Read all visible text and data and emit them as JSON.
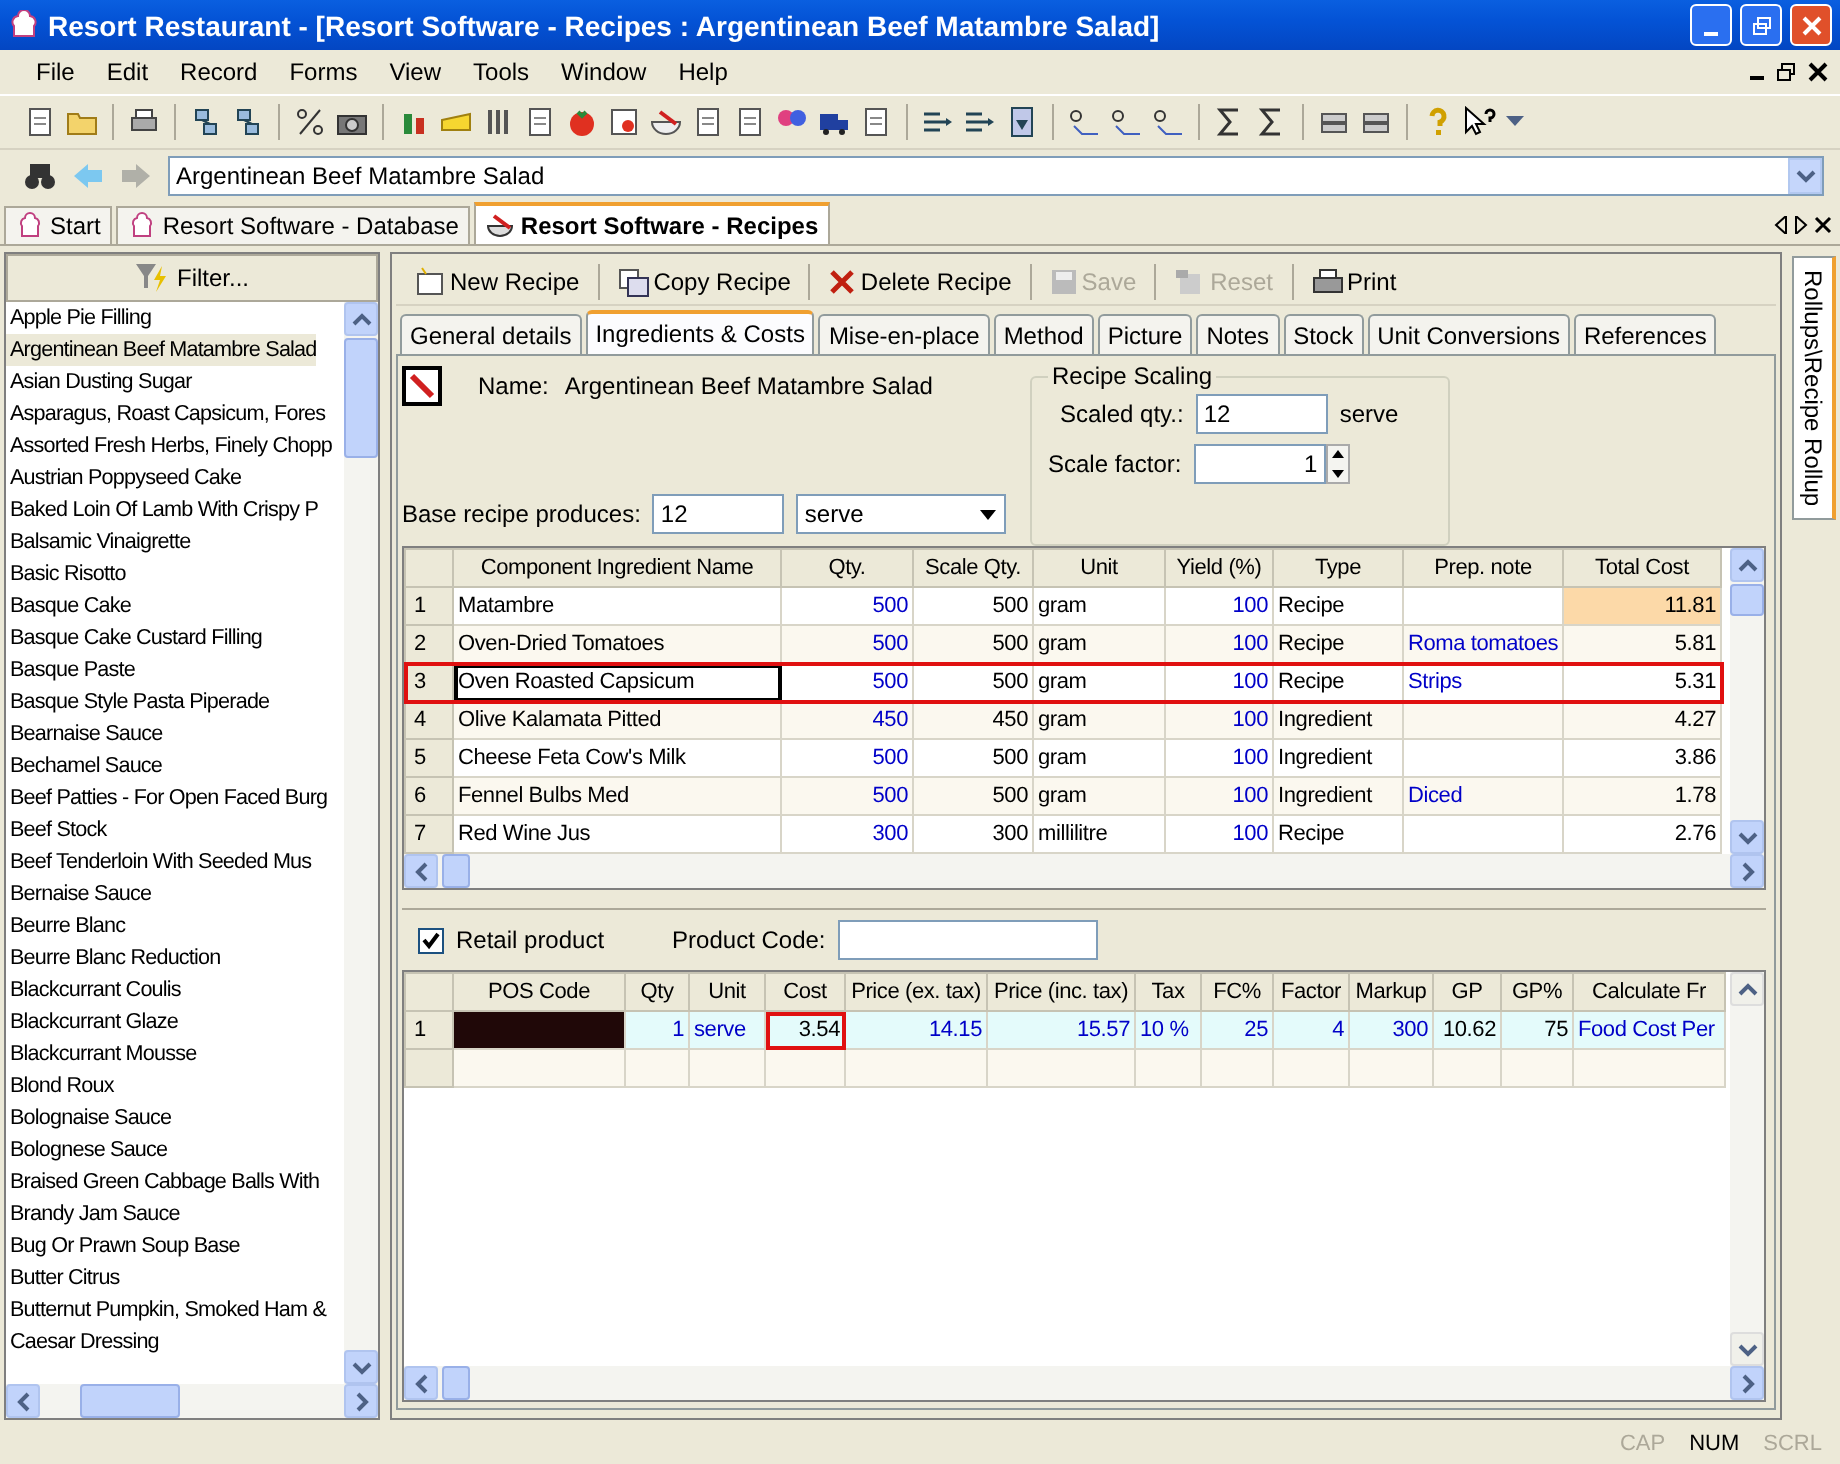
{
  "window": {
    "title": "Resort Restaurant - [Resort Software - Recipes : Argentinean Beef Matambre Salad]"
  },
  "menu": [
    "File",
    "Edit",
    "Record",
    "Forms",
    "View",
    "Tools",
    "Window",
    "Help"
  ],
  "address_bar": {
    "value": "Argentinean Beef Matambre Salad"
  },
  "doc_tabs": [
    {
      "label": "Start",
      "selected": false
    },
    {
      "label": "Resort Software - Database",
      "selected": false
    },
    {
      "label": "Resort Software - Recipes",
      "selected": true
    }
  ],
  "recipe_list": {
    "filter_button": "Filter...",
    "items": [
      {
        "name": "Apple Pie Filling",
        "selected": false
      },
      {
        "name": "Argentinean Beef Matambre Salad",
        "selected": true
      },
      {
        "name": "Asian Dusting Sugar",
        "selected": false
      },
      {
        "name": "Asparagus, Roast Capsicum, Fores",
        "selected": false
      },
      {
        "name": "Assorted Fresh Herbs, Finely Chopp",
        "selected": false
      },
      {
        "name": "Austrian Poppyseed Cake",
        "selected": false
      },
      {
        "name": "Baked Loin Of Lamb With Crispy P",
        "selected": false
      },
      {
        "name": "Balsamic Vinaigrette",
        "selected": false
      },
      {
        "name": "Basic Risotto",
        "selected": false
      },
      {
        "name": "Basque Cake",
        "selected": false
      },
      {
        "name": "Basque Cake Custard Filling",
        "selected": false
      },
      {
        "name": "Basque Paste",
        "selected": false
      },
      {
        "name": "Basque Style Pasta Piperade",
        "selected": false
      },
      {
        "name": "Bearnaise Sauce",
        "selected": false
      },
      {
        "name": "Bechamel Sauce",
        "selected": false
      },
      {
        "name": "Beef Patties - For Open Faced Burg",
        "selected": false
      },
      {
        "name": "Beef Stock",
        "selected": false
      },
      {
        "name": "Beef Tenderloin With Seeded Mus",
        "selected": false
      },
      {
        "name": "Bernaise Sauce",
        "selected": false
      },
      {
        "name": "Beurre Blanc",
        "selected": false
      },
      {
        "name": "Beurre Blanc Reduction",
        "selected": false
      },
      {
        "name": "Blackcurrant Coulis",
        "selected": false
      },
      {
        "name": "Blackcurrant Glaze",
        "selected": false
      },
      {
        "name": "Blackcurrant Mousse",
        "selected": false
      },
      {
        "name": "Blond Roux",
        "selected": false
      },
      {
        "name": "Bolognaise Sauce",
        "selected": false
      },
      {
        "name": "Bolognese Sauce",
        "selected": false
      },
      {
        "name": "Braised Green Cabbage Balls With",
        "selected": false
      },
      {
        "name": "Brandy Jam Sauce",
        "selected": false
      },
      {
        "name": "Bug Or Prawn Soup Base",
        "selected": false
      },
      {
        "name": "Butter Citrus",
        "selected": false
      },
      {
        "name": "Butternut Pumpkin, Smoked Ham &",
        "selected": false
      },
      {
        "name": "Caesar Dressing",
        "selected": false
      }
    ]
  },
  "recipe_toolbar": [
    {
      "kind": "new",
      "label": "New Recipe",
      "disabled": false
    },
    {
      "kind": "copy",
      "label": "Copy Recipe",
      "disabled": false
    },
    {
      "kind": "delete",
      "label": "Delete Recipe",
      "disabled": false
    },
    {
      "kind": "save",
      "label": "Save",
      "disabled": true
    },
    {
      "kind": "reset",
      "label": "Reset",
      "disabled": true
    },
    {
      "kind": "print",
      "label": "Print",
      "disabled": false
    }
  ],
  "tabs": [
    {
      "label": "General details",
      "selected": false
    },
    {
      "label": "Ingredients & Costs",
      "selected": true
    },
    {
      "label": "Mise-en-place",
      "selected": false
    },
    {
      "label": "Method",
      "selected": false
    },
    {
      "label": "Picture",
      "selected": false
    },
    {
      "label": "Notes",
      "selected": false
    },
    {
      "label": "Stock",
      "selected": false
    },
    {
      "label": "Unit Conversions",
      "selected": false
    },
    {
      "label": "References",
      "selected": false
    }
  ],
  "details": {
    "name_label": "Name:",
    "name_value": "Argentinean Beef Matambre Salad",
    "base_label": "Base recipe produces:",
    "base_qty": "12",
    "base_unit": "serve",
    "scaling": {
      "title": "Recipe Scaling",
      "scaled_label": "Scaled qty.:",
      "scaled_qty": "12",
      "scaled_unit": "serve",
      "factor_label": "Scale factor:",
      "factor": "1"
    }
  },
  "ingredients": {
    "columns": [
      "Component Ingredient Name",
      "Qty.",
      "Scale Qty.",
      "Unit",
      "Yield (%)",
      "Type",
      "Prep. note",
      "Total Cost"
    ],
    "rows": [
      {
        "num": "1",
        "cells": [
          "Matambre",
          "500",
          "500",
          "gram",
          "100",
          "Recipe",
          "",
          "11.81"
        ],
        "outlined": false,
        "cost_highlighted": true
      },
      {
        "num": "2",
        "cells": [
          "Oven-Dried Tomatoes",
          "500",
          "500",
          "gram",
          "100",
          "Recipe",
          "Roma tomatoes",
          "5.81"
        ],
        "outlined": false,
        "cost_highlighted": false
      },
      {
        "num": "3",
        "cells": [
          "Oven Roasted Capsicum",
          "500",
          "500",
          "gram",
          "100",
          "Recipe",
          "Strips",
          "5.31"
        ],
        "outlined": true,
        "cost_highlighted": false
      },
      {
        "num": "4",
        "cells": [
          "Olive Kalamata Pitted",
          "450",
          "450",
          "gram",
          "100",
          "Ingredient",
          "",
          "4.27"
        ],
        "outlined": false,
        "cost_highlighted": false
      },
      {
        "num": "5",
        "cells": [
          "Cheese Feta Cow's Milk",
          "500",
          "500",
          "gram",
          "100",
          "Ingredient",
          "",
          "3.86"
        ],
        "outlined": false,
        "cost_highlighted": false
      },
      {
        "num": "6",
        "cells": [
          "Fennel Bulbs Med",
          "500",
          "500",
          "gram",
          "100",
          "Ingredient",
          "Diced",
          "1.78"
        ],
        "outlined": false,
        "cost_highlighted": false
      },
      {
        "num": "7",
        "cells": [
          "Red Wine Jus",
          "300",
          "300",
          "millilitre",
          "100",
          "Recipe",
          "",
          "2.76"
        ],
        "outlined": false,
        "cost_highlighted": false
      }
    ]
  },
  "retail": {
    "label": "Retail product",
    "checked": true,
    "product_code_label": "Product Code:"
  },
  "pos": {
    "columns": [
      "POS Code",
      "Qty",
      "Unit",
      "Cost",
      "Price (ex. tax)",
      "Price (inc. tax)",
      "Tax",
      "FC%",
      "Factor",
      "Markup",
      "GP",
      "GP%",
      "Calculate Fr"
    ],
    "rows": [
      {
        "num": "1",
        "cells": [
          "",
          "1",
          "serve",
          "3.54",
          "14.15",
          "15.57",
          "10 %",
          "25",
          "4",
          "300",
          "10.62",
          "75",
          "Food Cost Per"
        ],
        "cost_outlined": true
      }
    ]
  },
  "side_tab": "Rollups\\Recipe Rollup",
  "status": [
    {
      "label": "CAP",
      "on": false
    },
    {
      "label": "NUM",
      "on": true
    },
    {
      "label": "SCRL",
      "on": false
    }
  ]
}
